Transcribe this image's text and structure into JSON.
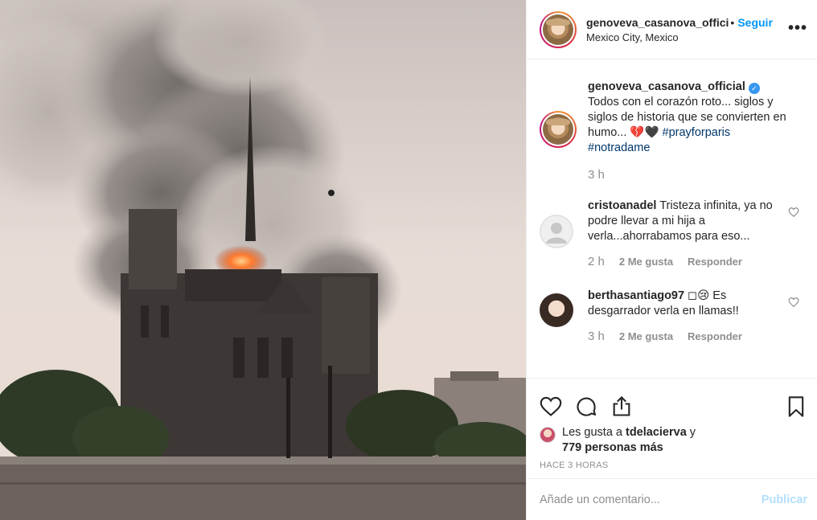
{
  "post": {
    "username_short": "genoveva_casanova_offici",
    "separator": "•",
    "follow_label": "Seguir",
    "location": "Mexico City, Mexico",
    "more_label": "•••"
  },
  "caption": {
    "username": "genoveva_casanova_official",
    "verified_mark": "✓",
    "text": "Todos con el corazón roto... siglos y siglos de historia que se convierten en humo... 💔🖤",
    "tag1": "#prayforparis",
    "tag2": "#notradame",
    "time": "3 h"
  },
  "comments": [
    {
      "username": "cristoanadel",
      "text": "Tristeza infinita, ya no podre llevar a mi hija a verla...ahorrabamos para eso...",
      "time": "2 h",
      "likes": "2 Me gusta",
      "reply": "Responder"
    },
    {
      "username": "berthasantiago97",
      "text": "◻😢 Es desgarrador verla en llamas!!",
      "time": "3 h",
      "likes": "2 Me gusta",
      "reply": "Responder"
    }
  ],
  "actions": {
    "likes_prefix": "Les gusta a ",
    "likes_user": "tdelacierva",
    "likes_mid": " y",
    "likes_count": "779 personas más",
    "ago": "HACE 3 HORAS"
  },
  "composer": {
    "placeholder": "Añade un comentario...",
    "publish_label": "Publicar"
  },
  "icons": [
    "heart-icon",
    "comment-icon",
    "share-icon",
    "bookmark-icon",
    "more-icon",
    "verified-icon"
  ],
  "colors": {
    "link": "#0095f6",
    "hashtag": "#00376b",
    "publish_disabled": "#b2dffc",
    "muted": "#8e8e8e"
  }
}
